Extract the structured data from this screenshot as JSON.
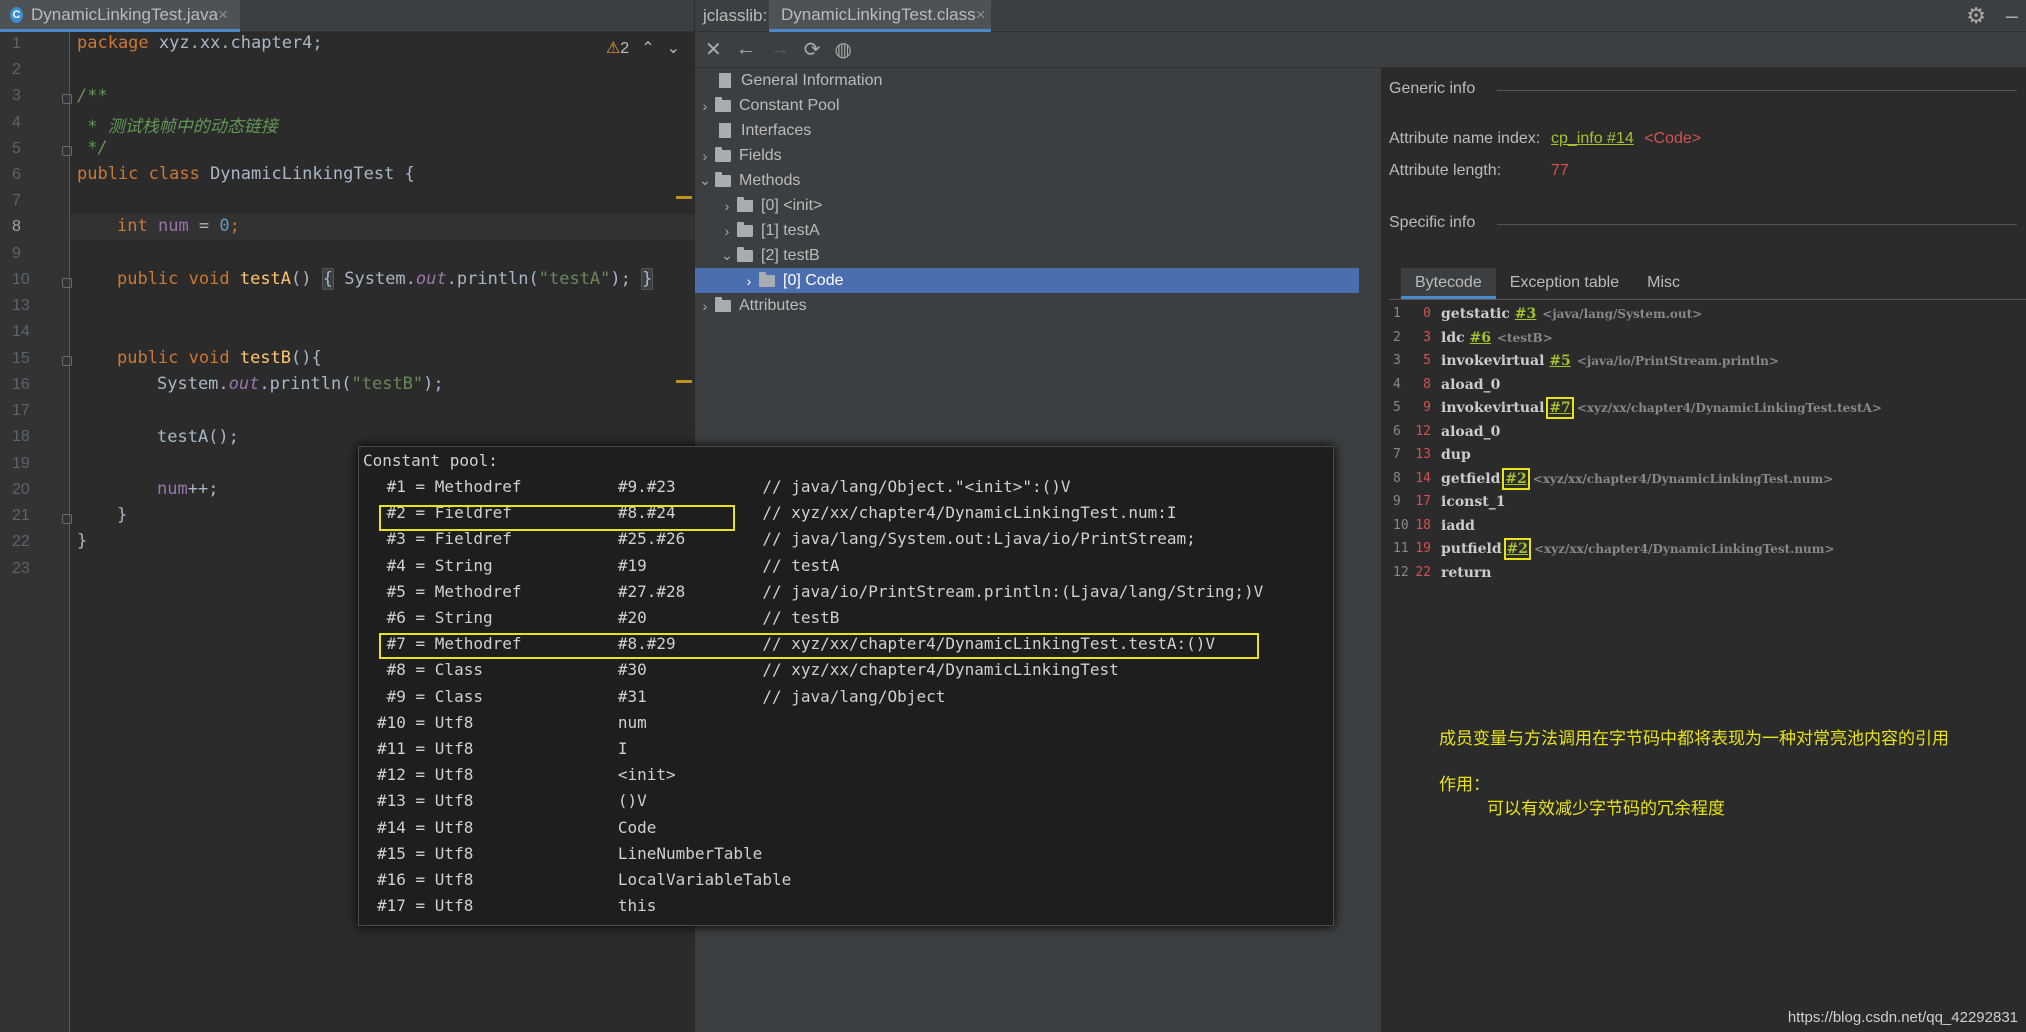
{
  "editor": {
    "tab_label": "DynamicLinkingTest.java",
    "tab_close": "×",
    "file_icon": "C",
    "warning_count": "2",
    "line_numbers": [
      "1",
      "2",
      "3",
      "4",
      "5",
      "6",
      "7",
      "8",
      "9",
      "10",
      "13",
      "14",
      "15",
      "16",
      "17",
      "18",
      "19",
      "20",
      "21",
      "22",
      "23"
    ],
    "current_line": "8",
    "code": {
      "l1_kw": "package",
      "l1_pkg": " xyz.xx.chapter4;",
      "l3": "/**",
      "l4": " * 测试栈帧中的动态链接",
      "l5": " */",
      "l6_kw": "public class",
      "l6_name": " DynamicLinkingTest",
      "l6_brace": " {",
      "l8_kw": "int",
      "l8_var": "num",
      "l8_eq": " = ",
      "l8_val": "0",
      "l8_semi": ";",
      "l10_kw": "public void",
      "l10_fn": "testA",
      "l10_paren": "()",
      "l10_b1": "{",
      "l10_sys": " System.",
      "l10_out": "out",
      "l10_pl": ".println(",
      "l10_str": "\"testA\"",
      "l10_end": "); ",
      "l10_b2": "}",
      "l15_kw": "public void",
      "l15_fn": " testB",
      "l15_rest": "(){",
      "l16_sys": "System.",
      "l16_out": "out",
      "l16_pl": ".println(",
      "l16_str": "\"testB\"",
      "l16_end": ");",
      "l18": "testA();",
      "l20_var": "num",
      "l20_rest": "++;",
      "l21": "}",
      "l22": "}"
    }
  },
  "jclasslib": {
    "label": "jclasslib:",
    "tab_label": "DynamicLinkingTest.class",
    "tab_close": "×",
    "tree": [
      {
        "label": "General Information"
      },
      {
        "label": "Constant Pool"
      },
      {
        "label": "Interfaces"
      },
      {
        "label": "Fields"
      },
      {
        "label": "Methods"
      },
      {
        "label": "[0] <init>"
      },
      {
        "label": "[1] testA"
      },
      {
        "label": "[2] testB"
      },
      {
        "label": "[0] Code"
      },
      {
        "label": "Attributes"
      }
    ],
    "generic_info": {
      "heading": "Generic info",
      "name_index_label": "Attribute name index:",
      "name_index_link": "cp_info #14",
      "name_index_value": "<Code>",
      "length_label": "Attribute length:",
      "length_value": "77"
    },
    "specific_info": {
      "heading": "Specific info",
      "tabs": [
        "Bytecode",
        "Exception table",
        "Misc"
      ]
    },
    "bytecode": [
      {
        "line": "1",
        "offset": "0",
        "instr": "getstatic",
        "ref": "#3",
        "comment": "<java/lang/System.out>"
      },
      {
        "line": "2",
        "offset": "3",
        "instr": "ldc",
        "ref": "#6",
        "comment": "<testB>"
      },
      {
        "line": "3",
        "offset": "5",
        "instr": "invokevirtual",
        "ref": "#5",
        "comment": "<java/io/PrintStream.println>"
      },
      {
        "line": "4",
        "offset": "8",
        "instr": "aload_0",
        "ref": "",
        "comment": ""
      },
      {
        "line": "5",
        "offset": "9",
        "instr": "invokevirtual",
        "ref": "#7",
        "comment": "<xyz/xx/chapter4/DynamicLinkingTest.testA>"
      },
      {
        "line": "6",
        "offset": "12",
        "instr": "aload_0",
        "ref": "",
        "comment": ""
      },
      {
        "line": "7",
        "offset": "13",
        "instr": "dup",
        "ref": "",
        "comment": ""
      },
      {
        "line": "8",
        "offset": "14",
        "instr": "getfield",
        "ref": "#2",
        "comment": "<xyz/xx/chapter4/DynamicLinkingTest.num>"
      },
      {
        "line": "9",
        "offset": "17",
        "instr": "iconst_1",
        "ref": "",
        "comment": ""
      },
      {
        "line": "10",
        "offset": "18",
        "instr": "iadd",
        "ref": "",
        "comment": ""
      },
      {
        "line": "11",
        "offset": "19",
        "instr": "putfield",
        "ref": "#2",
        "comment": "<xyz/xx/chapter4/DynamicLinkingTest.num>"
      },
      {
        "line": "12",
        "offset": "22",
        "instr": "return",
        "ref": "",
        "comment": ""
      }
    ],
    "notes": {
      "line1": "成员变量与方法调用在字节码中都将表现为一种对常亮池内容的引用",
      "line2": "作用：",
      "line3": "可以有效减少字节码的冗余程度"
    }
  },
  "constant_pool": {
    "title": "Constant pool:",
    "rows": [
      " #1 = Methodref          #9.#23         // java/lang/Object.\"<init>\":()V",
      " #2 = Fieldref           #8.#24         // xyz/xx/chapter4/DynamicLinkingTest.num:I",
      " #3 = Fieldref           #25.#26        // java/lang/System.out:Ljava/io/PrintStream;",
      " #4 = String             #19            // testA",
      " #5 = Methodref          #27.#28        // java/io/PrintStream.println:(Ljava/lang/String;)V",
      " #6 = String             #20            // testB",
      " #7 = Methodref          #8.#29         // xyz/xx/chapter4/DynamicLinkingTest.testA:()V",
      " #8 = Class              #30            // xyz/xx/chapter4/DynamicLinkingTest",
      " #9 = Class              #31            // java/lang/Object",
      "#10 = Utf8               num",
      "#11 = Utf8               I",
      "#12 = Utf8               <init>",
      "#13 = Utf8               ()V",
      "#14 = Utf8               Code",
      "#15 = Utf8               LineNumberTable",
      "#16 = Utf8               LocalVariableTable",
      "#17 = Utf8               this"
    ]
  },
  "watermark": "https://blog.csdn.net/qq_42292831",
  "colors": {
    "highlight": "#e8e316",
    "selection": "#4b6eaf",
    "link": "#a6c22b"
  }
}
